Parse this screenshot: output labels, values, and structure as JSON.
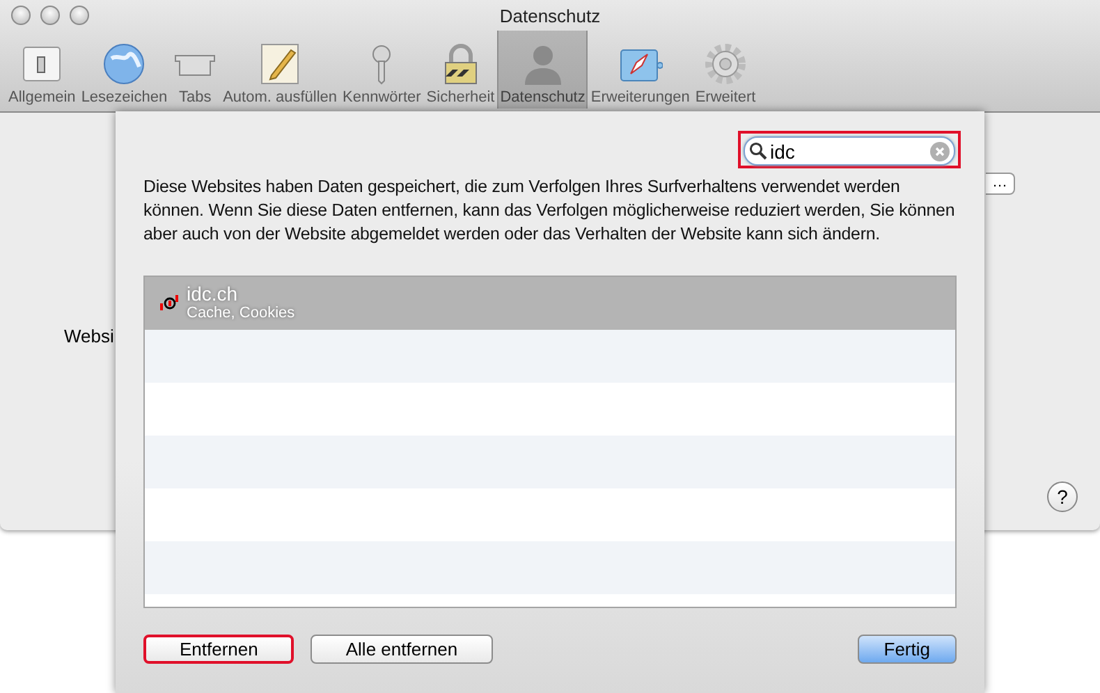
{
  "window": {
    "title": "Datenschutz"
  },
  "toolbar": [
    {
      "label": "Allgemein",
      "selected": false
    },
    {
      "label": "Lesezeichen",
      "selected": false
    },
    {
      "label": "Tabs",
      "selected": false
    },
    {
      "label": "Autom. ausfüllen",
      "selected": false
    },
    {
      "label": "Kennwörter",
      "selected": false
    },
    {
      "label": "Sicherheit",
      "selected": false
    },
    {
      "label": "Datenschutz",
      "selected": true
    },
    {
      "label": "Erweiterungen",
      "selected": false
    },
    {
      "label": "Erweitert",
      "selected": false
    }
  ],
  "background": {
    "websites_label": "Websi",
    "details_button": "…",
    "help_button": "?"
  },
  "sheet": {
    "search": {
      "value": "idc",
      "highlighted": true
    },
    "description": "Diese Websites haben Daten gespeichert, die zum Verfolgen Ihres Surfverhaltens verwendet werden können. Wenn Sie diese Daten entfernen, kann das Verfolgen möglicherweise reduziert werden, Sie können aber auch von der Website abgemeldet werden oder das Verhalten der Website kann sich ändern.",
    "sites": [
      {
        "name": "idc.ch",
        "details": "Cache, Cookies",
        "selected": true
      }
    ],
    "buttons": [
      {
        "label": "Entfernen",
        "kind": "plain",
        "highlighted": true
      },
      {
        "label": "Alle entfernen",
        "kind": "plain",
        "highlighted": false
      },
      {
        "label": "Fertig",
        "kind": "default",
        "highlighted": false
      }
    ]
  }
}
